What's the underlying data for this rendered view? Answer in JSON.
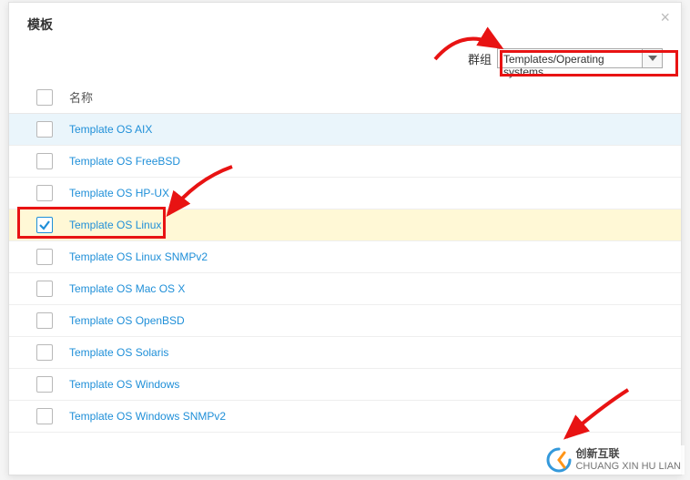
{
  "modal": {
    "title": "模板",
    "close_symbol": "×"
  },
  "group": {
    "label": "群组",
    "selected": "Templates/Operating systems"
  },
  "columns": {
    "name": "名称"
  },
  "templates": [
    {
      "name": "Template OS AIX",
      "checked": false,
      "hovered": true
    },
    {
      "name": "Template OS FreeBSD",
      "checked": false,
      "hovered": false
    },
    {
      "name": "Template OS HP-UX",
      "checked": false,
      "hovered": false
    },
    {
      "name": "Template OS Linux",
      "checked": true,
      "hovered": false
    },
    {
      "name": "Template OS Linux SNMPv2",
      "checked": false,
      "hovered": false
    },
    {
      "name": "Template OS Mac OS X",
      "checked": false,
      "hovered": false
    },
    {
      "name": "Template OS OpenBSD",
      "checked": false,
      "hovered": false
    },
    {
      "name": "Template OS Solaris",
      "checked": false,
      "hovered": false
    },
    {
      "name": "Template OS Windows",
      "checked": false,
      "hovered": false
    },
    {
      "name": "Template OS Windows SNMPv2",
      "checked": false,
      "hovered": false
    }
  ],
  "annotations": {
    "highlight_group_select": true,
    "highlight_selected_row": true,
    "arrows": true
  },
  "watermark": {
    "line1": "创新互联",
    "line2": "CHUANG XIN HU LIAN"
  }
}
